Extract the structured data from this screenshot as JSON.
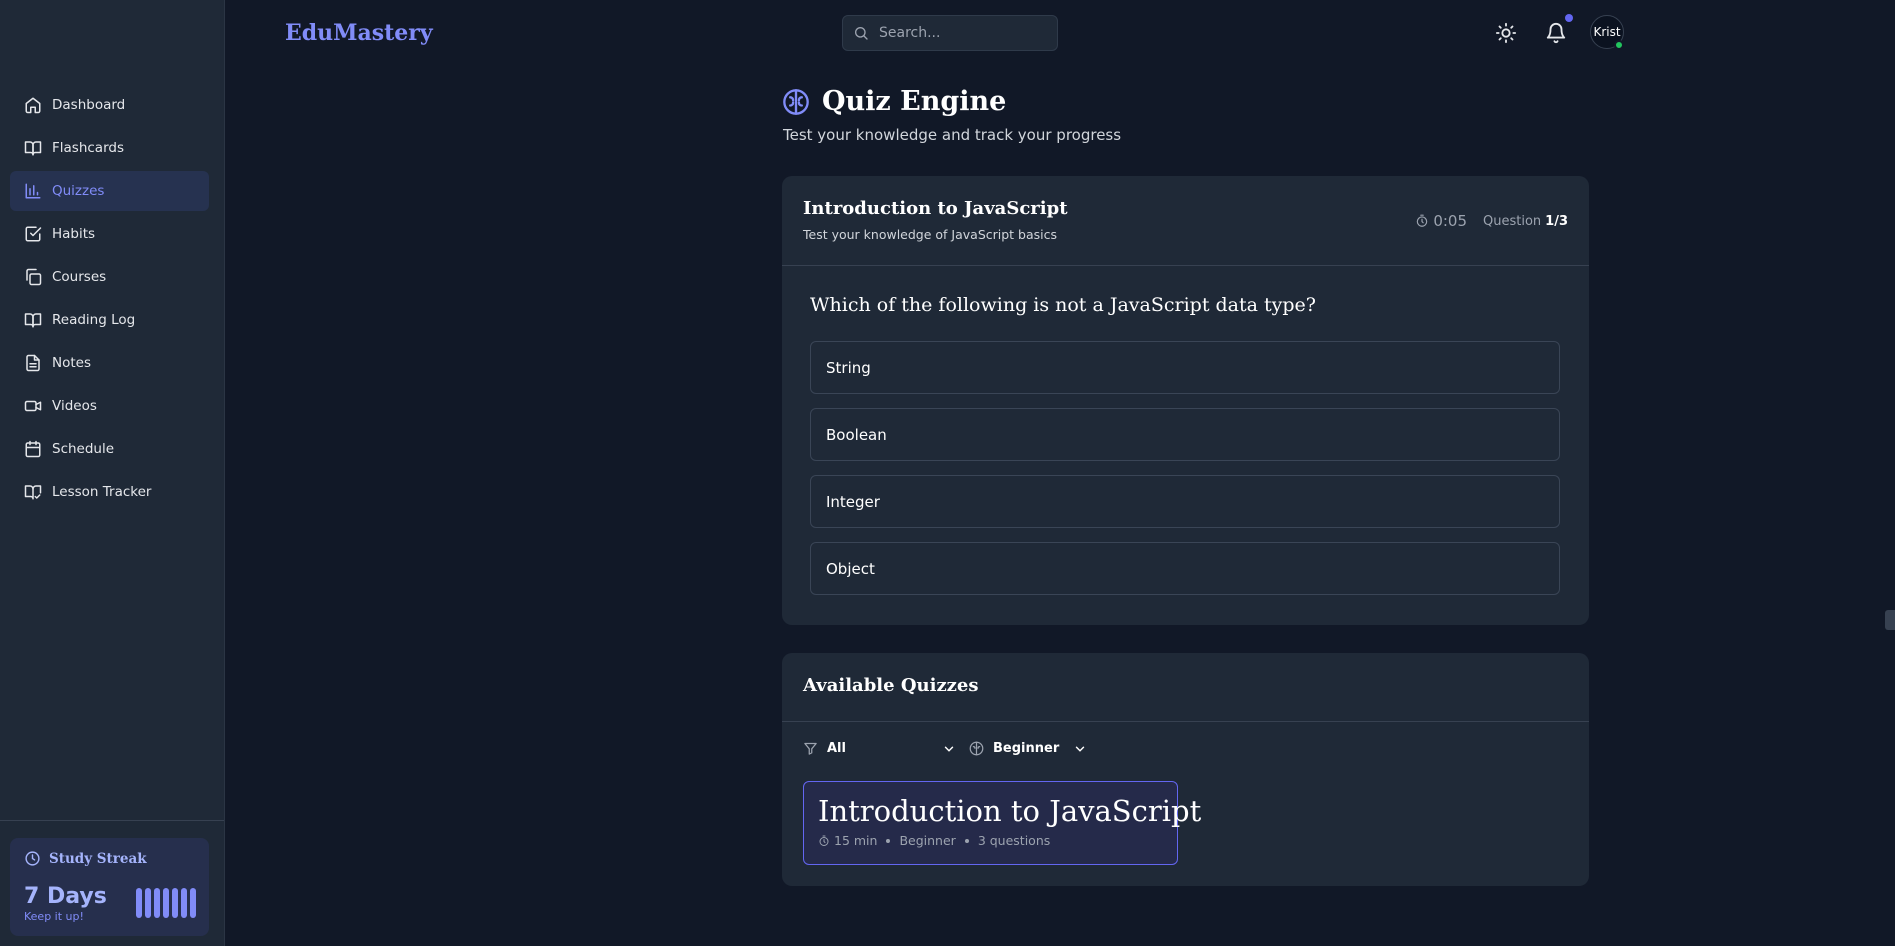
{
  "app": {
    "logo": "EduMastery"
  },
  "search": {
    "placeholder": "Search..."
  },
  "header": {
    "avatar_text": "Krist"
  },
  "sidebar": {
    "items": [
      {
        "label": "Dashboard",
        "icon": "home-icon"
      },
      {
        "label": "Flashcards",
        "icon": "book-open-icon"
      },
      {
        "label": "Quizzes",
        "icon": "bar-chart-icon",
        "active": true
      },
      {
        "label": "Habits",
        "icon": "check-square-icon"
      },
      {
        "label": "Courses",
        "icon": "copy-icon"
      },
      {
        "label": "Reading Log",
        "icon": "book-open-icon"
      },
      {
        "label": "Notes",
        "icon": "file-text-icon"
      },
      {
        "label": "Videos",
        "icon": "video-icon"
      },
      {
        "label": "Schedule",
        "icon": "calendar-icon"
      },
      {
        "label": "Lesson Tracker",
        "icon": "book-check-icon"
      }
    ],
    "streak": {
      "title": "Study Streak",
      "value": "7 Days",
      "subtitle": "Keep it up!",
      "bars": 7
    }
  },
  "page": {
    "title": "Quiz Engine",
    "subtitle": "Test your knowledge and track your progress"
  },
  "quiz": {
    "title": "Introduction to JavaScript",
    "description": "Test your knowledge of JavaScript basics",
    "timer": "0:05",
    "question_label": "Question",
    "question_count": "1/3",
    "question": "Which of the following is not a JavaScript data type?",
    "options": [
      "String",
      "Boolean",
      "Integer",
      "Object"
    ]
  },
  "available": {
    "title": "Available Quizzes",
    "filter_category": "All",
    "filter_level": "Beginner",
    "quizzes": [
      {
        "title": "Introduction to JavaScript",
        "duration": "15 min",
        "level": "Beginner",
        "questions": "3 questions"
      }
    ]
  },
  "colors": {
    "accent": "#818cf8",
    "background": "#111827",
    "card": "#1f2937",
    "online": "#22c55e"
  }
}
